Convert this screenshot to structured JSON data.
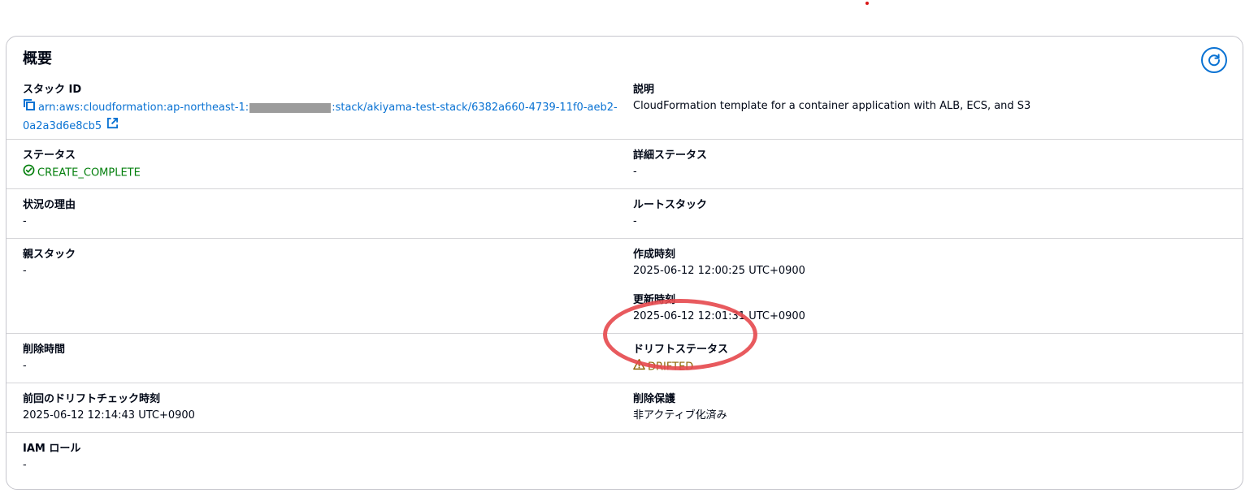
{
  "panel": {
    "title": "概要",
    "refresh_icon": "refresh-icon"
  },
  "fields": {
    "stack_id": {
      "label": "スタック ID",
      "value_prefix": "arn:aws:cloudformation:ap-northeast-1:",
      "value_suffix": ":stack/akiyama-test-stack/6382a660-4739-11f0-aeb2-0a2a3d6e8cb5"
    },
    "description": {
      "label": "説明",
      "value": "CloudFormation template for a container application with ALB, ECS, and S3"
    },
    "status": {
      "label": "ステータス",
      "value": "CREATE_COMPLETE"
    },
    "detailed_status": {
      "label": "詳細ステータス",
      "value": "-"
    },
    "status_reason": {
      "label": "状況の理由",
      "value": "-"
    },
    "root_stack": {
      "label": "ルートスタック",
      "value": "-"
    },
    "parent_stack": {
      "label": "親スタック",
      "value": "-"
    },
    "created_time": {
      "label": "作成時刻",
      "value": "2025-06-12 12:00:25 UTC+0900"
    },
    "updated_time": {
      "label": "更新時刻",
      "value": "2025-06-12 12:01:31 UTC+0900"
    },
    "deletion_time": {
      "label": "削除時間",
      "value": "-"
    },
    "drift_status": {
      "label": "ドリフトステータス",
      "value": "DRIFTED"
    },
    "last_drift_check": {
      "label": "前回のドリフトチェック時刻",
      "value": "2025-06-12 12:14:43 UTC+0900"
    },
    "termination_protection": {
      "label": "削除保護",
      "value": "非アクティブ化済み"
    },
    "iam_role": {
      "label": "IAM ロール",
      "value": "-"
    }
  },
  "colors": {
    "link": "#0972d3",
    "success": "#037f0c",
    "warning": "#8d6605",
    "annotation": "#e5484d"
  }
}
